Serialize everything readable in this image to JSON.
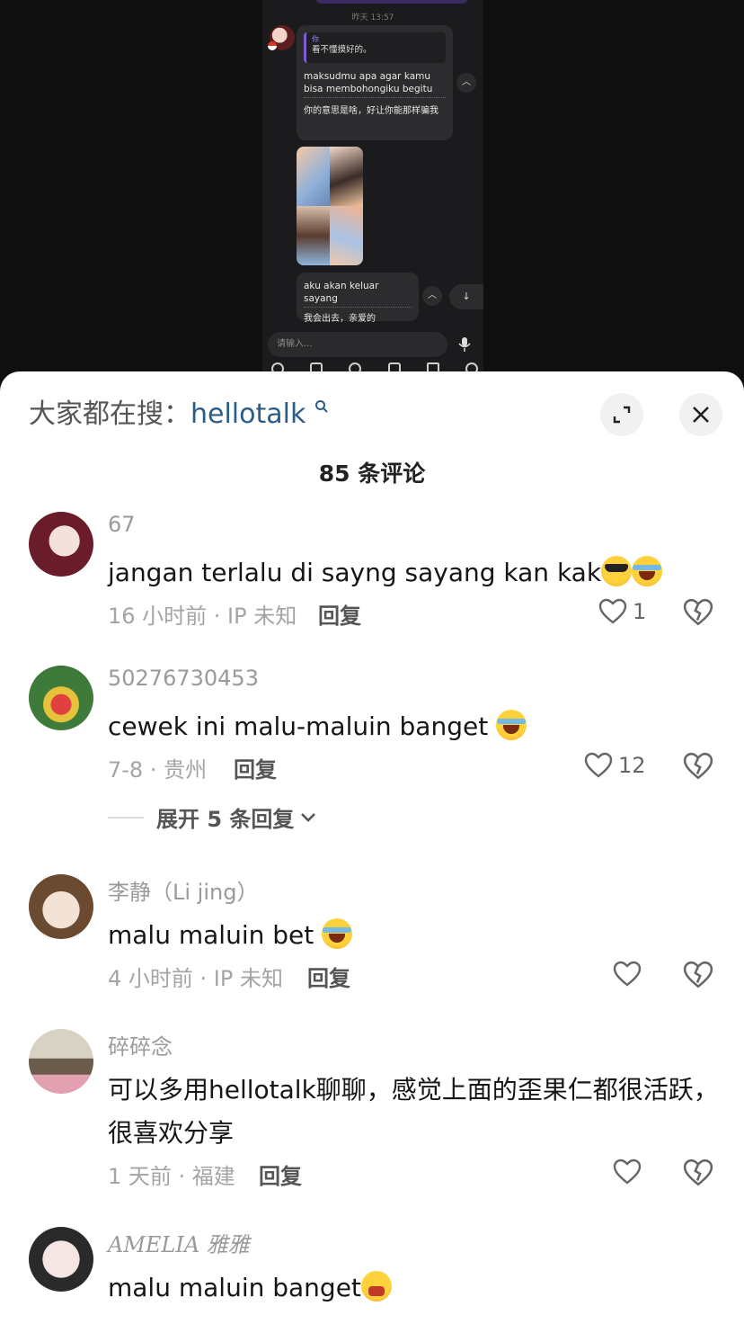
{
  "video": {
    "timestamp": "昨天 13:57",
    "quote_author": "你",
    "quote_text": "看不懂摸好的。",
    "bubble1_original": "maksudmu apa agar kamu bisa membohongiku begitu",
    "bubble1_translation": "你的意思是啥，好让你能那样骗我",
    "bubble3_original": "aku akan keluar sayang",
    "bubble3_translation": "我会出去，亲爱的",
    "input_placeholder": "请输入..."
  },
  "header": {
    "search_prefix": "大家都在搜：",
    "search_keyword": "hellotalk",
    "comment_count_title": "85 条评论"
  },
  "comments": [
    {
      "user": "67",
      "text": "jangan terlalu di sayng sayang kan kak",
      "meta": "16 小时前 · IP 未知",
      "reply": "回复",
      "likes": "1"
    },
    {
      "user": "50276730453",
      "text": "cewek ini malu-maluin banget ",
      "meta": "7-8 · 贵州",
      "reply": "回复",
      "likes": "12",
      "expand": "展开 5 条回复"
    },
    {
      "user": "李静（Li jing）",
      "text": "malu maluin bet ",
      "meta": "4 小时前 · IP 未知",
      "reply": "回复"
    },
    {
      "user": "碎碎念",
      "text": "可以多用hellotalk聊聊，感觉上面的歪果仁都很活跃，很喜欢分享",
      "meta": "1 天前 · 福建",
      "reply": "回复"
    },
    {
      "user": "AMELIA 雅雅",
      "text": "malu maluin banget"
    }
  ],
  "colors": {
    "sheet_bg": "#ffffff",
    "keyword": "#2a5d8a",
    "dark_bg": "#0f0f10"
  }
}
